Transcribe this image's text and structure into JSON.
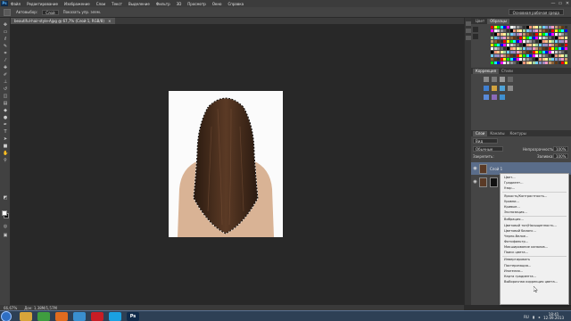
{
  "app": {
    "logo": "Ps",
    "window_controls": [
      "—",
      "▭",
      "✕"
    ]
  },
  "menubar": {
    "items": [
      "Файл",
      "Редактирование",
      "Изображение",
      "Слои",
      "Текст",
      "Выделение",
      "Фильтр",
      "3D",
      "Просмотр",
      "Окно",
      "Справка"
    ]
  },
  "options_bar": {
    "antialias": "Автовыбор:",
    "mode_value": "Слой",
    "show_controls": "Показать упр. элем.",
    "workspace": "Основная рабочая среда"
  },
  "document": {
    "tab_title": "beautiful-hair-style-Ajpg @ 67,7% (Слой 1, RGB/8)",
    "icon": "×"
  },
  "status_bar": {
    "zoom": "66,67%",
    "doc_size": "Док: 1,38М/1,57М"
  },
  "panels": {
    "swatches_tabs": [
      "Цвет",
      "Образцы"
    ],
    "adjust_tabs": [
      "Коррекция",
      "Стили"
    ],
    "layers_tabs": [
      "Слои",
      "Каналы",
      "Контуры"
    ],
    "kind_label": "Вид",
    "blend_mode": "Обычные",
    "opacity_label": "Непрозрачность:",
    "opacity_value": "100%",
    "lock_label": "Закрепить:",
    "fill_label": "Заливка:",
    "fill_value": "100%",
    "layers": [
      {
        "name": "Слой 1"
      },
      {
        "name": "Фон"
      }
    ]
  },
  "context_menu": {
    "groups": [
      [
        "Цвет...",
        "Градиент...",
        "Узор..."
      ],
      [
        "Яркость/Контрастность...",
        "Уровни...",
        "Кривые...",
        "Экспозиция..."
      ],
      [
        "Вибрация...",
        "Цветовой тон/Насыщенность...",
        "Цветовой баланс...",
        "Черно-белое...",
        "Фотофильтр...",
        "Микширование каналов...",
        "Поиск цвета..."
      ],
      [
        "Инвертировать",
        "Постеризация...",
        "Изогелия...",
        "Карта градиента...",
        "Выборочная коррекция цвета..."
      ]
    ]
  },
  "taskbar": {
    "lang": "RU",
    "time": "18:41",
    "date": "12.09.2013",
    "apps": [
      {
        "icon": "folder-icon",
        "color": "#d9a53a"
      },
      {
        "icon": "chrome-icon",
        "color": "#3f9d3f"
      },
      {
        "icon": "firefox-icon",
        "color": "#e06b1f"
      },
      {
        "icon": "media-icon",
        "color": "#3a8fd0"
      },
      {
        "icon": "opera-icon",
        "color": "#c81d25"
      },
      {
        "icon": "skype-icon",
        "color": "#1aa1e1"
      },
      {
        "icon": "photoshop-icon",
        "color": "#0f2a4a",
        "label": "Ps"
      }
    ]
  },
  "colors": {
    "interface_bg": "#2b2b2b",
    "panel_bg": "#454545",
    "hair": "#3b2619",
    "skin": "#d9b395",
    "foreground": "#ffffff",
    "background": "#111111"
  }
}
